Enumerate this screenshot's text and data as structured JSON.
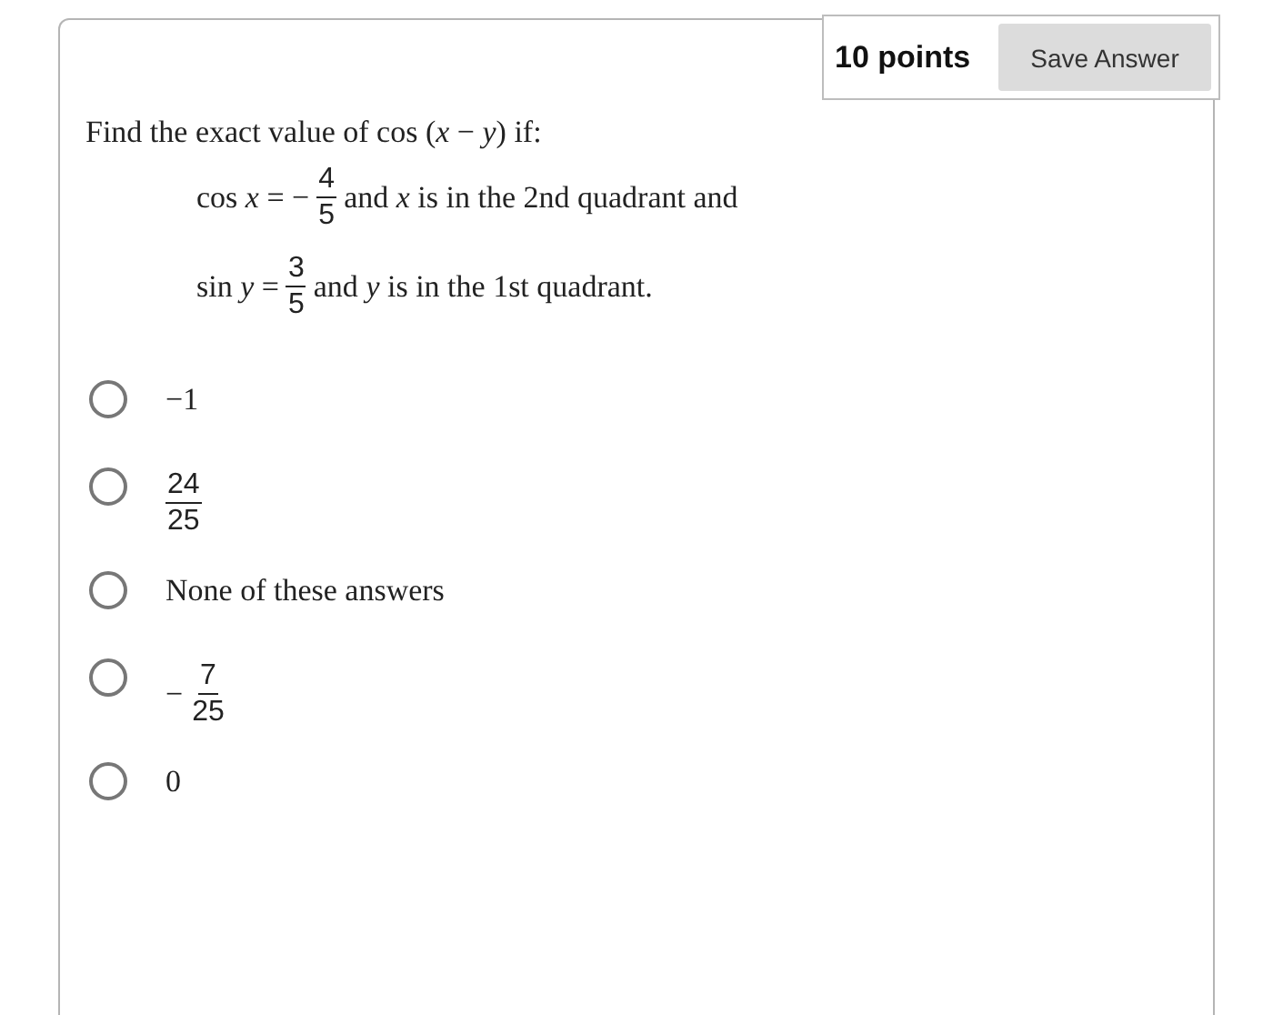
{
  "points": "10 points",
  "save_button": "Save Answer",
  "prompt": "Find the exact value of cos (*x* − *y*) if:",
  "conditions": [
    [
      {
        "kind": "text",
        "text": "cos *x* = −"
      },
      {
        "kind": "frac",
        "num": "4",
        "den": "5"
      },
      {
        "kind": "text",
        "text": "and *x* is in the 2nd quadrant and"
      }
    ],
    [
      {
        "kind": "text",
        "text": "sin *y* ="
      },
      {
        "kind": "frac",
        "num": "3",
        "den": "5"
      },
      {
        "kind": "text",
        "text": "and *y* is in the 1st quadrant."
      }
    ]
  ],
  "options": [
    {
      "selected": false,
      "parts": [
        {
          "kind": "text",
          "text": "−1"
        }
      ]
    },
    {
      "selected": false,
      "parts": [
        {
          "kind": "frac",
          "num": "24",
          "den": "25"
        }
      ]
    },
    {
      "selected": false,
      "parts": [
        {
          "kind": "text",
          "text": "None of these answers"
        }
      ]
    },
    {
      "selected": false,
      "parts": [
        {
          "kind": "text",
          "text": "−"
        },
        {
          "kind": "frac",
          "num": "7",
          "den": "25"
        }
      ]
    },
    {
      "selected": false,
      "parts": [
        {
          "kind": "text",
          "text": "0"
        }
      ]
    }
  ]
}
